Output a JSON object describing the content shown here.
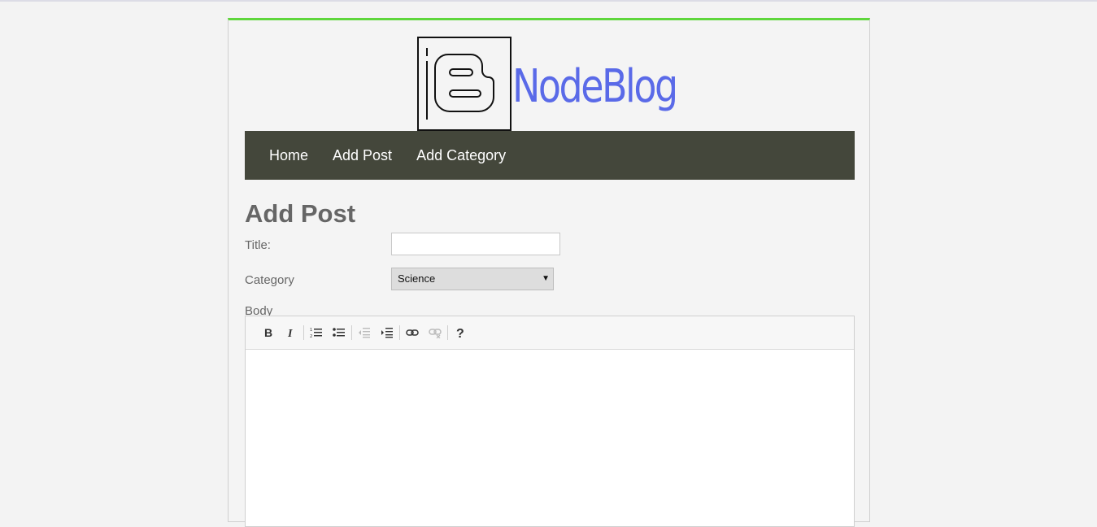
{
  "brand": {
    "name": "NodeBlog",
    "color": "#5a6ae8",
    "logo_icon": "blogger-icon"
  },
  "nav": {
    "items": [
      {
        "label": "Home"
      },
      {
        "label": "Add Post"
      },
      {
        "label": "Add Category"
      }
    ],
    "background": "#44473b"
  },
  "page": {
    "title": "Add Post",
    "accent": "#5fd63c"
  },
  "form": {
    "title_label": "Title:",
    "title_value": "",
    "category_label": "Category",
    "category_selected": "Science",
    "body_label": "Body"
  },
  "editor": {
    "toolbar": [
      {
        "icon": "bold-icon",
        "glyph": "B"
      },
      {
        "icon": "italic-icon",
        "glyph": "I"
      },
      {
        "icon": "ordered-list-icon"
      },
      {
        "icon": "unordered-list-icon"
      },
      {
        "icon": "outdent-icon",
        "disabled": true
      },
      {
        "icon": "indent-icon"
      },
      {
        "icon": "link-icon"
      },
      {
        "icon": "unlink-icon",
        "disabled": true
      },
      {
        "icon": "help-icon",
        "glyph": "?"
      }
    ]
  }
}
